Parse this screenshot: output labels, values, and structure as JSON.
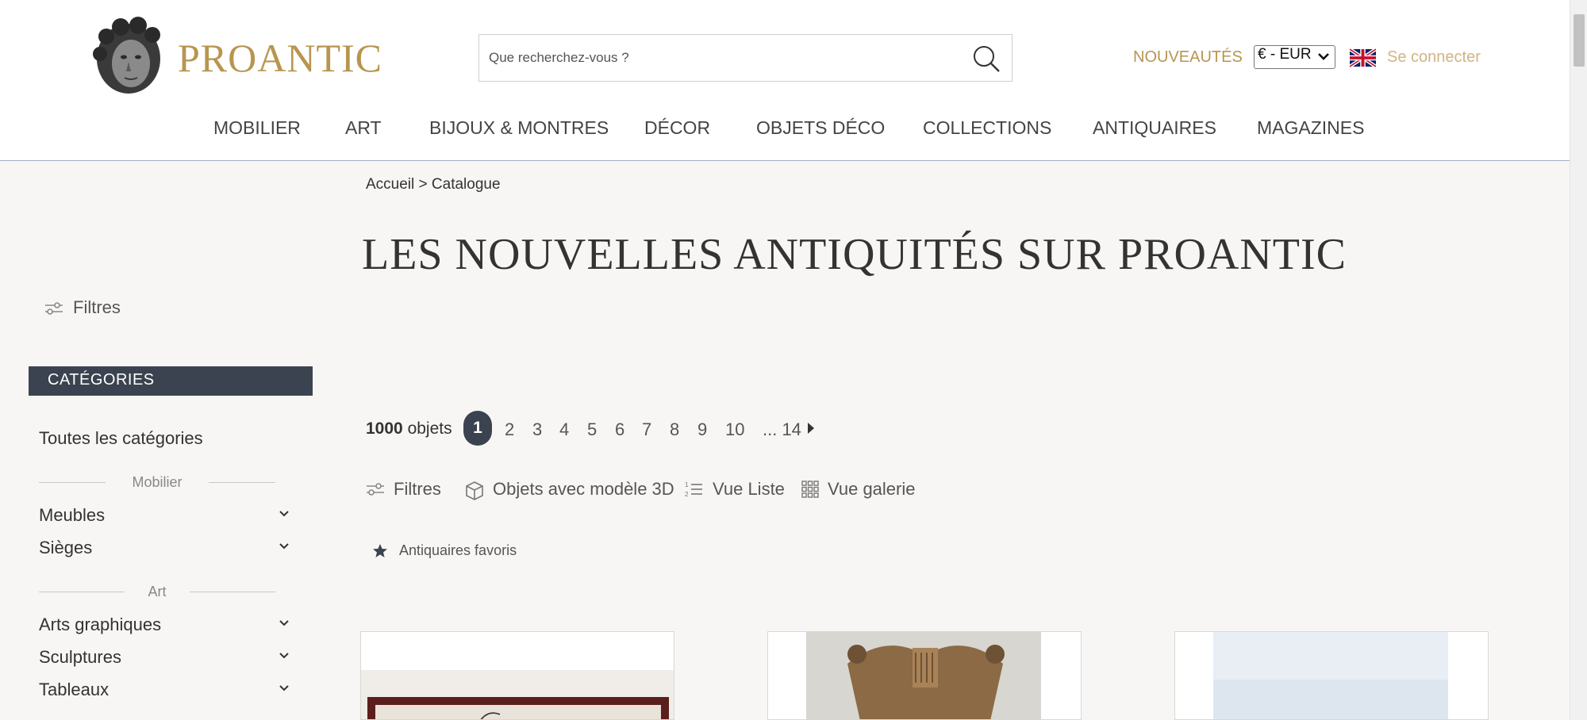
{
  "header": {
    "logo_text": "PROANTIC",
    "search": {
      "placeholder": "Que recherchez-vous ?"
    },
    "nouveautes": "NOUVEAUTÉS",
    "currency": "€ - EUR",
    "login": "Se connecter"
  },
  "nav": [
    "MOBILIER",
    "ART",
    "BIJOUX & MONTRES",
    "DÉCOR",
    "OBJETS DÉCO",
    "COLLECTIONS",
    "ANTIQUAIRES",
    "MAGAZINES"
  ],
  "breadcrumb": {
    "home": "Accueil",
    "separator": ">",
    "current": "Catalogue"
  },
  "page_title": "LES NOUVELLES ANTIQUITÉS SUR PROANTIC",
  "sidebar": {
    "filters_label": "Filtres",
    "categories_header": "CATÉGORIES",
    "all_categories": "Toutes les catégories",
    "groups": [
      {
        "title": "Mobilier",
        "items": [
          "Meubles",
          "Sièges"
        ]
      },
      {
        "title": "Art",
        "items": [
          "Arts graphiques",
          "Sculptures",
          "Tableaux"
        ]
      }
    ]
  },
  "results": {
    "count_number": "1000",
    "count_label": "objets",
    "pages": [
      "1",
      "2",
      "3",
      "4",
      "5",
      "6",
      "7",
      "8",
      "9",
      "10"
    ],
    "last_page": "... 14"
  },
  "toolbar": {
    "filters": "Filtres",
    "model3d": "Objets avec modèle 3D",
    "list_view": "Vue Liste",
    "gallery_view": "Vue galerie"
  },
  "favorites": "Antiquaires favoris",
  "colors": {
    "brand_gold": "#b8954f",
    "dark_slate": "#3b4350",
    "background": "#f7f6f4"
  }
}
